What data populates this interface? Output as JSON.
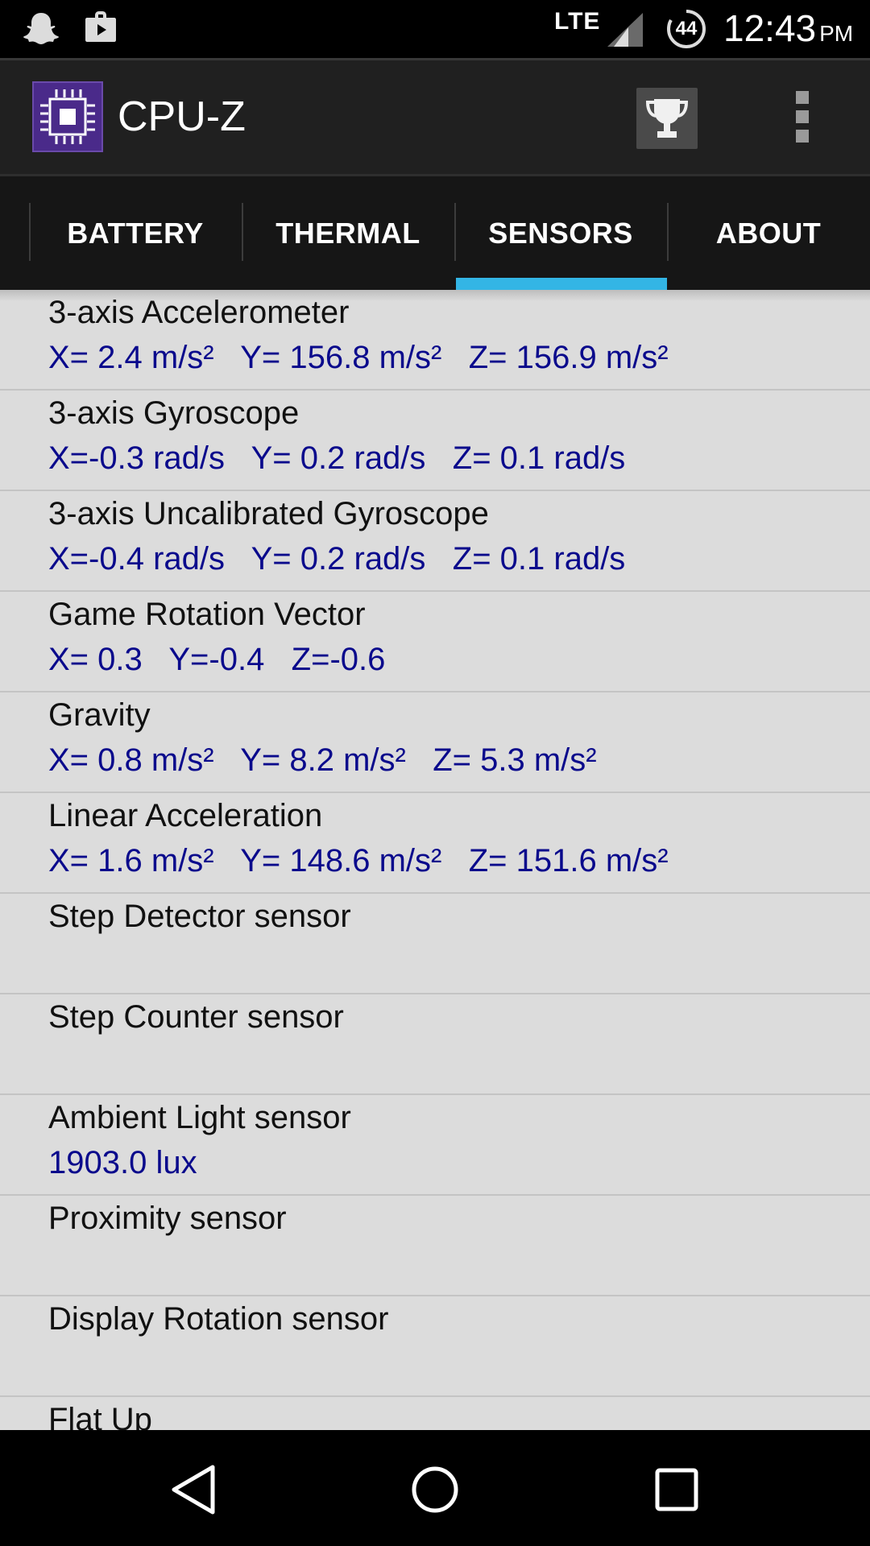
{
  "status_bar": {
    "network": "LTE",
    "battery_level": "44",
    "time": "12:43",
    "ampm": "PM",
    "icons": [
      "snapchat-ghost-icon",
      "shopping-bag-icon",
      "signal-icon",
      "battery-circle-icon"
    ]
  },
  "app_bar": {
    "title": "CPU-Z",
    "logo_icon": "cpu-chip-icon",
    "action_icon": "trophy-icon",
    "overflow_icon": "overflow-menu-icon"
  },
  "tabs": [
    {
      "label": "BATTERY",
      "selected": false
    },
    {
      "label": "THERMAL",
      "selected": false
    },
    {
      "label": "SENSORS",
      "selected": true
    },
    {
      "label": "ABOUT",
      "selected": false
    }
  ],
  "colors": {
    "accent": "#33b5e5",
    "value_text": "#0a0a8c",
    "list_bg": "#dcdcdc",
    "app_bar_bg": "#202020"
  },
  "sensors": [
    {
      "name": "3-axis Accelerometer",
      "value": "X= 2.4 m/s²   Y= 156.8 m/s²   Z= 156.9 m/s²"
    },
    {
      "name": "3-axis Gyroscope",
      "value": "X=-0.3 rad/s   Y= 0.2 rad/s   Z= 0.1 rad/s"
    },
    {
      "name": "3-axis Uncalibrated Gyroscope",
      "value": "X=-0.4 rad/s   Y= 0.2 rad/s   Z= 0.1 rad/s"
    },
    {
      "name": "Game Rotation Vector",
      "value": "X= 0.3   Y=-0.4   Z=-0.6"
    },
    {
      "name": "Gravity",
      "value": "X= 0.8 m/s²   Y= 8.2 m/s²   Z= 5.3 m/s²"
    },
    {
      "name": "Linear Acceleration",
      "value": "X= 1.6 m/s²   Y= 148.6 m/s²   Z= 151.6 m/s²"
    },
    {
      "name": "Step Detector sensor",
      "value": ""
    },
    {
      "name": "Step Counter sensor",
      "value": ""
    },
    {
      "name": "Ambient Light sensor",
      "value": "1903.0 lux"
    },
    {
      "name": "Proximity sensor",
      "value": ""
    },
    {
      "name": "Display Rotation sensor",
      "value": ""
    },
    {
      "name": "Flat Up",
      "value": ""
    }
  ],
  "nav_bar": {
    "icons": [
      "back-icon",
      "home-icon",
      "recents-icon"
    ]
  }
}
